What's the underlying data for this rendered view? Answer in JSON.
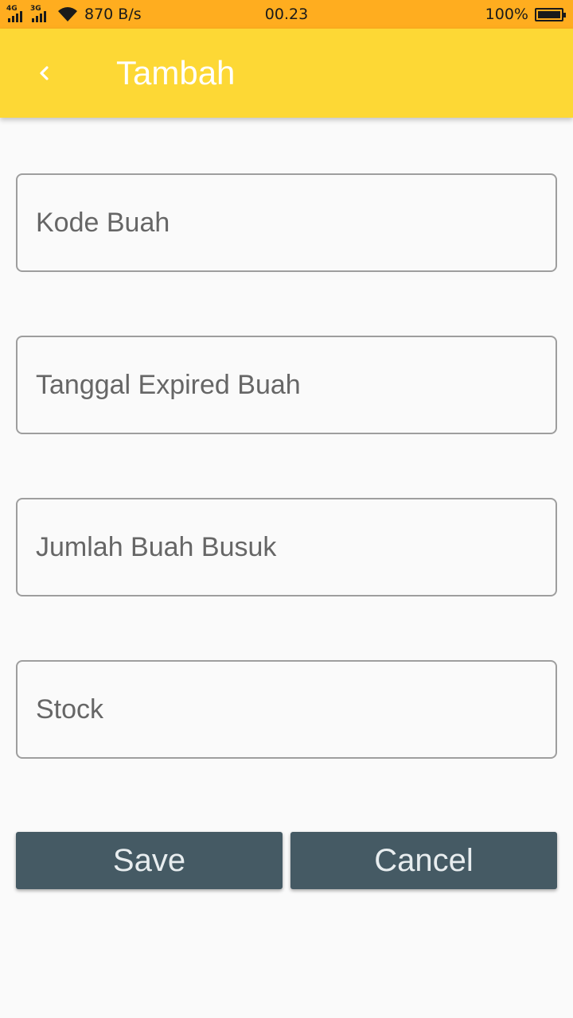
{
  "status_bar": {
    "net1": "4G",
    "net2": "3G",
    "rate": "870 B/s",
    "time": "00.23",
    "battery": "100%",
    "battery_level": 1.0
  },
  "app_bar": {
    "title": "Tambah",
    "back_icon": "chevron-left-icon",
    "background": "#fdd835"
  },
  "form": {
    "fields": [
      {
        "placeholder": "Kode Buah",
        "value": ""
      },
      {
        "placeholder": "Tanggal Expired Buah",
        "value": ""
      },
      {
        "placeholder": "Jumlah Buah Busuk",
        "value": ""
      },
      {
        "placeholder": "Stock",
        "value": ""
      }
    ]
  },
  "actions": {
    "save_label": "Save",
    "cancel_label": "Cancel",
    "button_color": "#455a64"
  }
}
